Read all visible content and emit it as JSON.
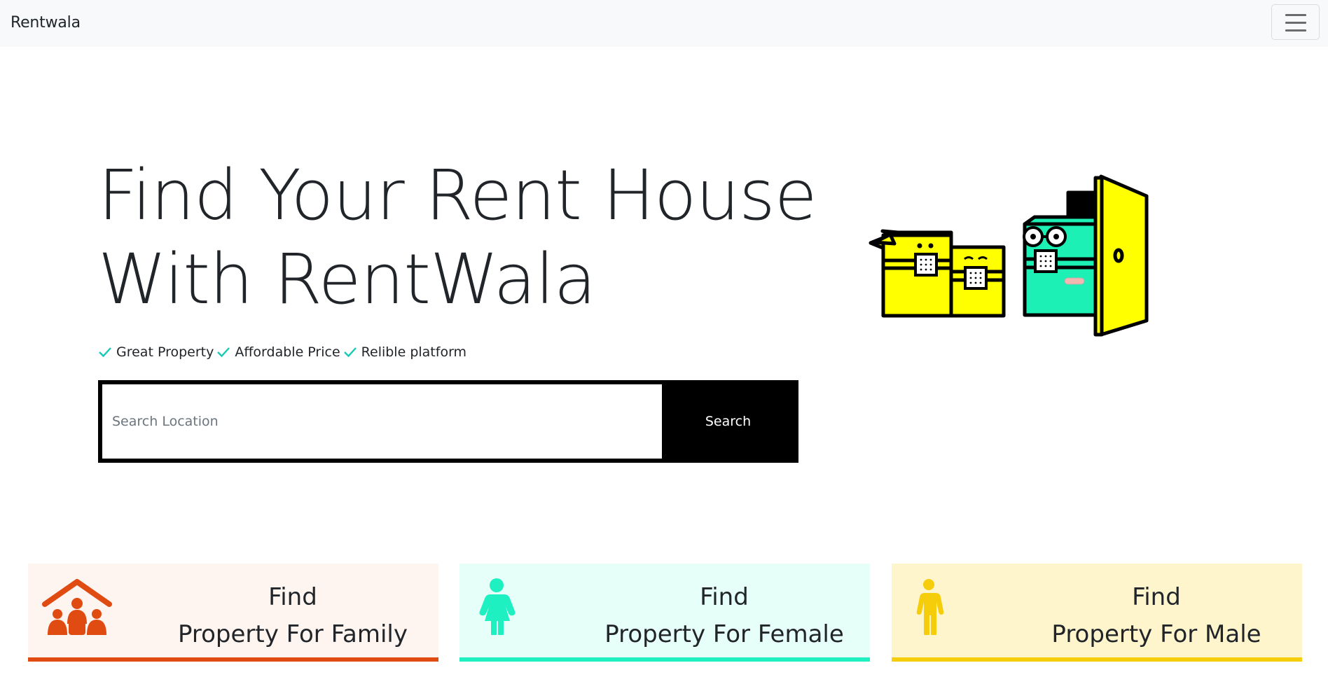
{
  "navbar": {
    "brand": "Rentwala",
    "menu_icon": "hamburger-menu-icon"
  },
  "hero": {
    "title_line1": "Find Your Rent House",
    "title_line2": "With RentWala",
    "features": [
      {
        "icon": "check-icon",
        "label": "Great Property"
      },
      {
        "icon": "check-icon",
        "label": "Affordable Price"
      },
      {
        "icon": "check-icon",
        "label": "Relible platform"
      }
    ],
    "search": {
      "placeholder": "Search Location",
      "value": "",
      "button_label": "Search"
    },
    "illustration": "moving-boxes-door-illustration"
  },
  "categories": [
    {
      "icon": "family-house-icon",
      "line1": "Find",
      "line2": "Property For Family",
      "accent": "#e04b12",
      "background": "#fff5f0"
    },
    {
      "icon": "female-person-icon",
      "line1": "Find",
      "line2": "Property For Female",
      "accent": "#1ff0c2",
      "background": "#e6fff8"
    },
    {
      "icon": "male-person-icon",
      "line1": "Find",
      "line2": "Property For Male",
      "accent": "#f5cd0a",
      "background": "#fff5cc"
    }
  ],
  "colors": {
    "check": "#17c9b5",
    "navbar_bg": "#f8f9fa",
    "search_button_bg": "#000000"
  }
}
